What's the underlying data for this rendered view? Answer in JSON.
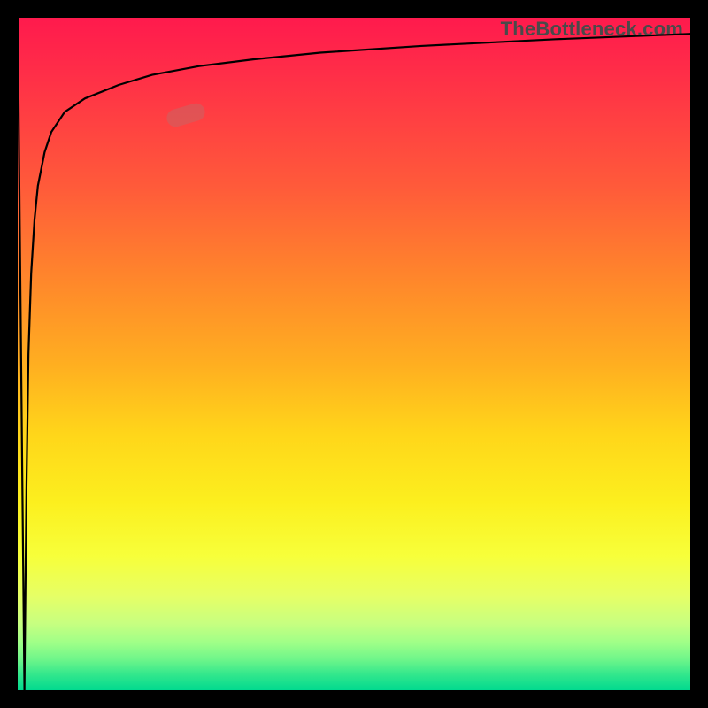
{
  "watermark": {
    "text": "TheBottleneck.com"
  },
  "chart_data": {
    "type": "line",
    "title": "",
    "xlabel": "",
    "ylabel": "",
    "xlim": [
      0,
      100
    ],
    "ylim": [
      0,
      100
    ],
    "grid": false,
    "legend": null,
    "annotations": [
      {
        "kind": "marker-pill",
        "x_pct": 25,
        "y_pct_from_top": 14.5,
        "rotate_deg": -16
      }
    ],
    "background_gradient": {
      "direction": "vertical",
      "stops": [
        {
          "pos": 0.0,
          "color": "#ff1a4d",
          "meaning": "high"
        },
        {
          "pos": 0.5,
          "color": "#ffb020"
        },
        {
          "pos": 0.8,
          "color": "#f7ff3a"
        },
        {
          "pos": 1.0,
          "color": "#00d98f",
          "meaning": "low"
        }
      ]
    },
    "series": [
      {
        "name": "curve",
        "x": [
          0.0,
          0.5,
          1.0,
          1.3,
          1.6,
          2.0,
          2.5,
          3.0,
          4.0,
          5.0,
          7.0,
          10.0,
          15.0,
          20.0,
          27.0,
          35.0,
          45.0,
          60.0,
          80.0,
          100.0
        ],
        "y": [
          100.0,
          50.0,
          0.0,
          30.0,
          50.0,
          62.0,
          70.0,
          75.0,
          80.0,
          83.0,
          86.0,
          88.0,
          90.0,
          91.5,
          92.8,
          93.8,
          94.8,
          95.8,
          96.8,
          97.6
        ]
      }
    ]
  },
  "colors": {
    "curve_stroke": "#000000",
    "frame_bg": "#000000",
    "marker_fill": "rgba(200,100,100,0.55)"
  }
}
